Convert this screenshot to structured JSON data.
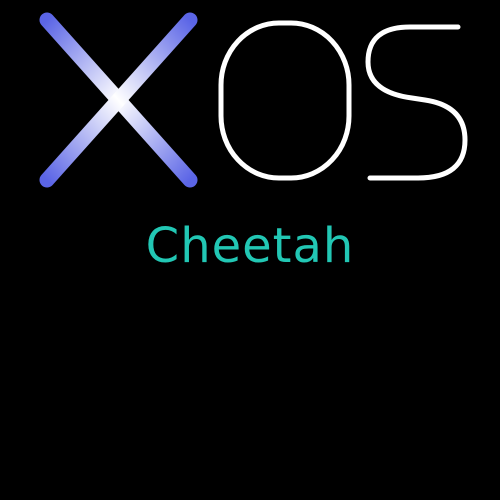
{
  "logo": {
    "wordmark": "XOS",
    "x_glyph": "X",
    "o_glyph": "O",
    "s_glyph": "S",
    "x_gradient_colors": [
      "#5b65e6",
      "#ffffff",
      "#5b65e6"
    ],
    "letter_color": "#ffffff"
  },
  "edition": {
    "name": "Cheetah",
    "color": "#22c7b4"
  },
  "background_color": "#000000"
}
